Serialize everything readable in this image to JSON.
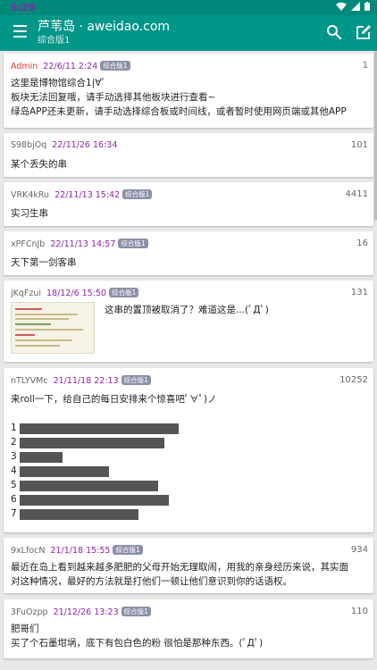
{
  "status": {
    "time": "5:29"
  },
  "app": {
    "title": "芦苇岛 · aweidao.com",
    "subtitle": "综合版1"
  },
  "threads": [
    {
      "uid": "Admin",
      "time": "22/6/11 2:24",
      "badge": "综合版1",
      "count": "1",
      "lines": [
        "这里是博物馆综合1|∀ﾟ",
        "板块无法回复哦，请手动选择其他板块进行查看~",
        "绿岛APP还未更新，请手动选择综合板或时间线，或者暂时使用网页端或其他APP"
      ]
    },
    {
      "uid": "S98bjOq",
      "time": "22/11/26 16:34",
      "badge": "综合版1",
      "count": "101",
      "lines": [
        "某个丢失的串"
      ]
    },
    {
      "uid": "VRK4kRu",
      "time": "22/11/13 15:42",
      "badge": "综合版1",
      "count": "4411",
      "lines": [
        "实习生串"
      ]
    },
    {
      "uid": "xPFCnJb",
      "time": "22/11/13 14:57",
      "badge": "综合版1",
      "count": "16",
      "lines": [
        "天下第一剑客串"
      ]
    },
    {
      "uid": "jKqFzui",
      "time": "18/12/6 15:50",
      "badge": "综合版1",
      "count": "131",
      "lines": [
        "这串的置顶被取消了？难道这是...(ﾟДﾟ)"
      ]
    },
    {
      "uid": "nTLYVMc",
      "time": "21/11/18 22:13",
      "badge": "综合版1",
      "count": "10252",
      "lines": [
        "来roll一下，给自己的每日安排来个惊喜吧ﾟ∀ﾟ)ノ"
      ],
      "bars": [
        {
          "label": "1",
          "value": 178
        },
        {
          "label": "2",
          "value": 162
        },
        {
          "label": "3",
          "value": 48
        },
        {
          "label": "4",
          "value": 100
        },
        {
          "label": "5",
          "value": 155
        },
        {
          "label": "6",
          "value": 167
        },
        {
          "label": "7",
          "value": 133
        }
      ]
    },
    {
      "uid": "9xLfocN",
      "time": "21/1/18 15:55",
      "badge": "综合版1",
      "count": "934",
      "lines": [
        "最近在岛上看到越来越多肥肥的父母开始无理取闹，用我的亲身经历来说，其实面",
        "对这种情况，最好的方法就是打他们一顿让他们意识到你的话语权。"
      ]
    },
    {
      "uid": "3FuOzpp",
      "time": "21/12/26 13:23",
      "badge": "综合版1",
      "count": "110",
      "lines": [
        "肥哥们",
        "买了个石墨坩埚，底下有包白色的粉 很怕是那种东西。(ﾟДﾟ)"
      ]
    }
  ]
}
